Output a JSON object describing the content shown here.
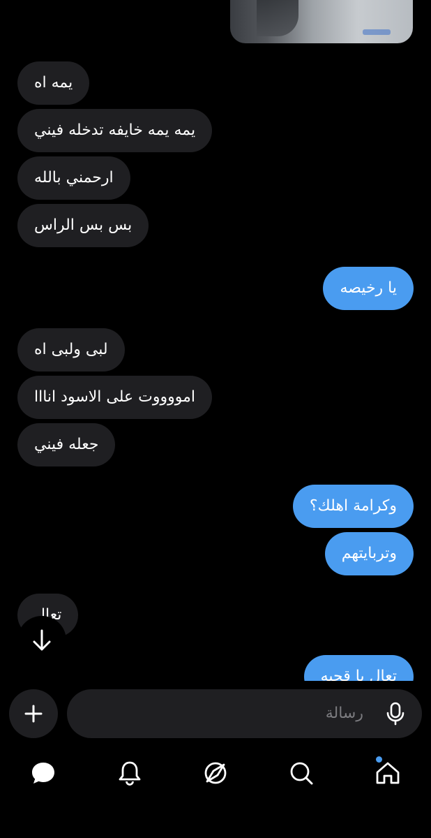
{
  "messages": [
    {
      "dir": "in",
      "text": "يمه اه"
    },
    {
      "dir": "in",
      "text": "يمه يمه خايفه تدخله فيني"
    },
    {
      "dir": "in",
      "text": "ارحمني بالله"
    },
    {
      "dir": "in",
      "text": "بس بس الراس"
    },
    {
      "dir": "out",
      "text": "يا رخيصه"
    },
    {
      "dir": "in",
      "text": "لبى ولبى اه"
    },
    {
      "dir": "in",
      "text": "امووووت على الاسود انااا"
    },
    {
      "dir": "in",
      "text": "جعله فيني"
    },
    {
      "dir": "out",
      "text": "وكرامة اهلك؟"
    },
    {
      "dir": "out",
      "text": "وتربايتهم"
    },
    {
      "dir": "in",
      "text": "تعال"
    },
    {
      "dir": "out",
      "text": "تعال يا قحبه"
    }
  ],
  "composer": {
    "placeholder": "رسالة"
  },
  "tabs": [
    "messages-icon",
    "bell-icon",
    "compass-icon",
    "search-icon",
    "home-icon"
  ],
  "colors": {
    "background": "#000000",
    "incoming_bubble": "#1f1f22",
    "outgoing_bubble": "#4a9cf0",
    "accent": "#4a9cf0"
  }
}
